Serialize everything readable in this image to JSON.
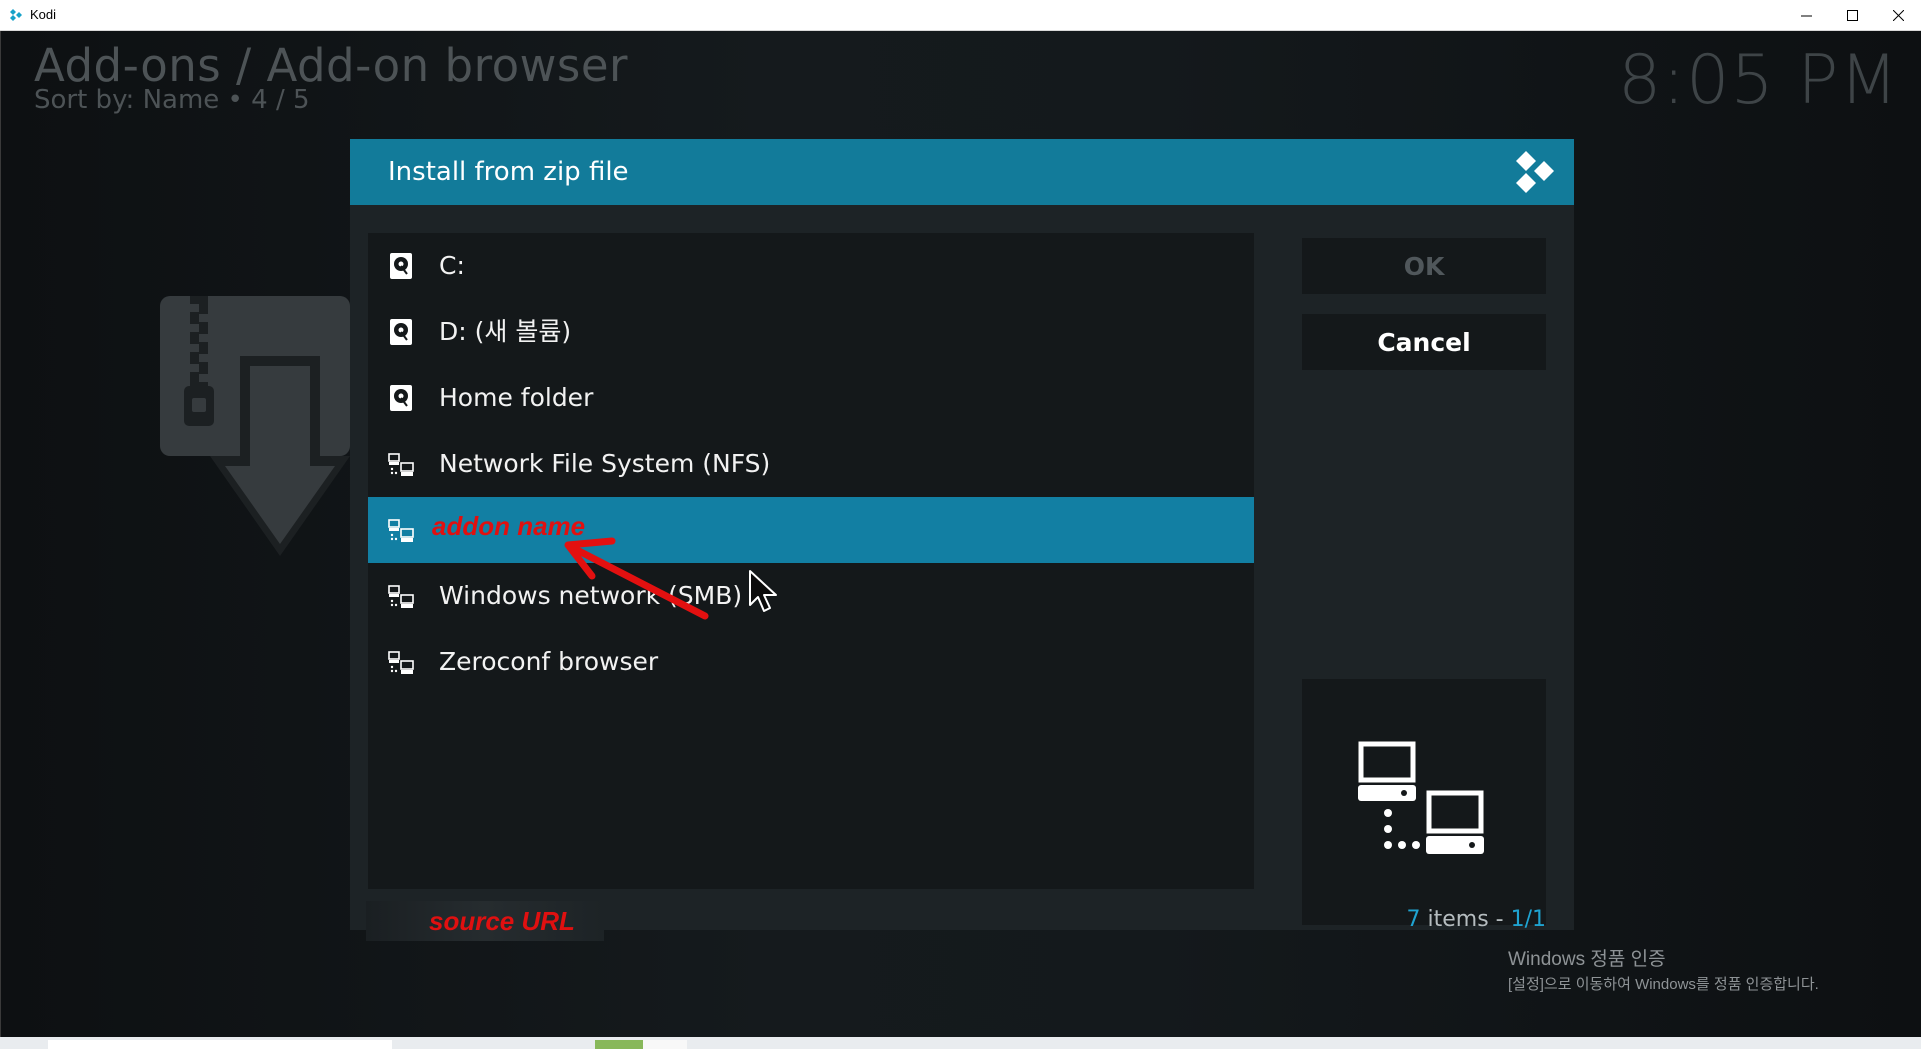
{
  "window": {
    "title": "Kodi"
  },
  "header": {
    "title": "Add-ons / Add-on browser",
    "sort": "Sort by: Name  •  4 / 5",
    "clock": "8:05 PM"
  },
  "dialog": {
    "title": "Install from zip file",
    "items": [
      {
        "label": "C:",
        "icon": "hard-drive-icon"
      },
      {
        "label": "D: (새 볼륨)",
        "icon": "hard-drive-icon"
      },
      {
        "label": "Home folder",
        "icon": "hard-drive-icon"
      },
      {
        "label": "Network File System (NFS)",
        "icon": "network-icon"
      },
      {
        "label": "addon name",
        "icon": "network-icon",
        "selected": true
      },
      {
        "label": "Windows network (SMB)",
        "icon": "network-icon"
      },
      {
        "label": "Zeroconf browser",
        "icon": "network-icon"
      }
    ],
    "ok_label": "OK",
    "cancel_label": "Cancel",
    "source_label": "source URL",
    "count": {
      "num": "7",
      "text": " items - ",
      "page": "1/1"
    }
  },
  "activation": {
    "line1": "Windows 정품 인증",
    "line2": "[설정]으로 이동하여 Windows를 정품 인증합니다."
  },
  "colors": {
    "accent": "#127b9a",
    "selected": "#127fa3",
    "annotation": "#e01010"
  }
}
